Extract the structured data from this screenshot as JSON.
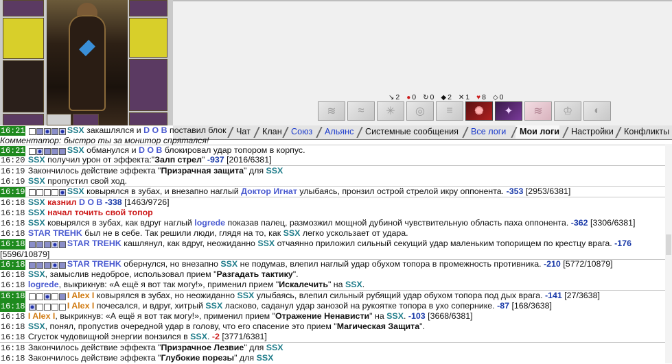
{
  "stats": [
    {
      "icon": "arrow-icon",
      "glyph": "↘",
      "value": "2"
    },
    {
      "icon": "blood-drop-icon",
      "glyph": "●",
      "value": "0"
    },
    {
      "icon": "swirl-icon",
      "glyph": "↻",
      "value": "0"
    },
    {
      "icon": "shield-icon",
      "glyph": "◆",
      "value": "2"
    },
    {
      "icon": "crossed-swords-icon",
      "glyph": "✕",
      "value": "1"
    },
    {
      "icon": "heart-icon",
      "glyph": "♥",
      "value": "8"
    },
    {
      "icon": "shield-outline-icon",
      "glyph": "◇",
      "value": "0"
    }
  ],
  "skills": [
    {
      "icon": "skill-1-icon",
      "glyph": "≋",
      "style": "gray"
    },
    {
      "icon": "skill-2-icon",
      "glyph": "≈",
      "style": "gray"
    },
    {
      "icon": "skill-3-icon",
      "glyph": "✳",
      "style": "gray"
    },
    {
      "icon": "skill-4-icon",
      "glyph": "◎",
      "style": "gray"
    },
    {
      "icon": "skill-5-icon",
      "glyph": "≡",
      "style": "gray"
    },
    {
      "icon": "skill-6-icon",
      "glyph": "✺",
      "style": "red"
    },
    {
      "icon": "skill-7-icon",
      "glyph": "✦",
      "style": "violet"
    },
    {
      "icon": "skill-8-icon",
      "glyph": "≋",
      "style": "pink"
    },
    {
      "icon": "skill-9-icon",
      "glyph": "♔",
      "style": "gray"
    },
    {
      "icon": "skill-10-icon",
      "glyph": "◐",
      "style": "gray"
    }
  ],
  "tabs": [
    {
      "label": "Чат",
      "kind": "plain"
    },
    {
      "label": "Клан",
      "kind": "plain"
    },
    {
      "label": "Союз",
      "kind": "link"
    },
    {
      "label": "Альянс",
      "kind": "link"
    },
    {
      "label": "Системные сообщения",
      "kind": "plain"
    },
    {
      "label": "Все логи",
      "kind": "link"
    },
    {
      "label": "Мои логи",
      "kind": "active"
    },
    {
      "label": "Настройки",
      "kind": "plain"
    },
    {
      "label": "Конфликты",
      "kind": "plain"
    }
  ],
  "log": {
    "t0": "16:21",
    "t1": "16:21",
    "t2": "16:20",
    "t3": "16:19",
    "t4": "16:19",
    "t5": "16:19",
    "t6": "16:18",
    "t7": "16:18",
    "t8": "16:18",
    "t9": "16:18",
    "t10": "16:18",
    "t11": "16:18",
    "t12": "16:18",
    "t13": "16:18",
    "t14": "16:18",
    "t15": "16:18",
    "t16": "16:18",
    "t17": "16:18",
    "t18": "16:18",
    "t19": "16:18",
    "t20": "16:18",
    "t21": "16:18",
    "ssx": "SSX",
    "dob": "D O B",
    "star": "STAR TREHK",
    "doc": "Доктор Игнат",
    "logrede": "logrede",
    "alex": "I Alex I",
    "l0_a": "закашлялся и",
    "l0_b": "поставил блок",
    "commentator": "Комментатор: быстро ты за монитор спрятался!",
    "l1_a": "обманулся и",
    "l1_b": "блокировал удар топором в корпус.",
    "l2_a": "получил урон от эффекта:\"",
    "l2_b": "Залп стрел",
    "l2_c": "\"",
    "l2_dmg": "-937",
    "l2_hp": "[2016/6381]",
    "l3_a": "Закончилось действие эффекта \"",
    "l3_b": "Призрачная защита",
    "l3_c": "\" для",
    "l4_a": "пропустил свой ход.",
    "l5_a": "ковырялся в зубах, и внезапно наглый",
    "l5_b": "улыбаясь, пронзил острой стрелой икру оппонента.",
    "l5_dmg": "-353",
    "l5_hp": "[2953/6381]",
    "l6_a": "казнил",
    "l6_dmg": "-338",
    "l6_hp": "[1463/9726]",
    "l7_a": "начал точить свой топор",
    "l8_a": "ковырялся в зубах, как вдруг наглый",
    "l8_b": "показав палец, размозжил мощной дубиной чувствительную область паха оппонента.",
    "l8_dmg": "-362",
    "l8_hp": "[3306/6381]",
    "l9_a": "был не в себе. Так решили люди, глядя на то, как",
    "l9_b": "легко ускользает от удара.",
    "l10_a": "кашлянул, как вдруг, неожиданно",
    "l10_b": "отчаянно приложил сильный секущий удар маленьким топорищем по крестцу врага.",
    "l10_dmg": "-176",
    "l10_hp": "[5596/10879]",
    "l11_a": "обернулся, но внезапно",
    "l11_b": "не подумав, влепил наглый удар обухом топора в промежность противника.",
    "l11_dmg": "-210",
    "l11_hp": "[5772/10879]",
    "l12_a": ", замыслив недоброе, использовал прием \"",
    "l12_b": "Разгадать тактику",
    "l12_c": "\".",
    "l13_a": ", выкрикнув: «А ещё я вот так могу!», применил прием \"",
    "l13_b": "Искалечить",
    "l13_c": "\" на",
    "l13_d": ".",
    "l14_a": "ковырялся в зубах, но неожиданно",
    "l14_b": "улыбаясь, влепил сильный рубящий удар обухом топора под дых врага.",
    "l14_dmg": "-141",
    "l14_hp": "[27/3638]",
    "l15_a": "почесался, и вдруг, хитрый",
    "l15_b": "ласково, саданул удар занозой на рукоятке топора в ухо сопернике.",
    "l15_dmg": "-87",
    "l15_hp": "[168/3638]",
    "l16_a": ", выкрикнув: «А ещё я вот так могу!», применил прием \"",
    "l16_b": "Отражение Ненависти",
    "l16_c": "\" на",
    "l16_d": ".",
    "l16_dmg": "-103",
    "l16_hp": "[3668/6381]",
    "l17_a": ", понял, пропустив очередной удар в голову, что его спасение это прием \"",
    "l17_b": "Магическая Защита",
    "l17_c": "\".",
    "l18_a": "Сгусток чудовищной энергии вонзился в",
    "l18_b": ".",
    "l18_dmg": "-2",
    "l18_hp": "[3771/6381]",
    "l19_a": "Закончилось действие эффекта \"",
    "l19_b": "Призрачное Лезвие",
    "l19_c": "\" для",
    "l20_a": "Закончилось действие эффекта \"",
    "l20_b": "Глубокие порезы",
    "l20_c": "\" для"
  }
}
